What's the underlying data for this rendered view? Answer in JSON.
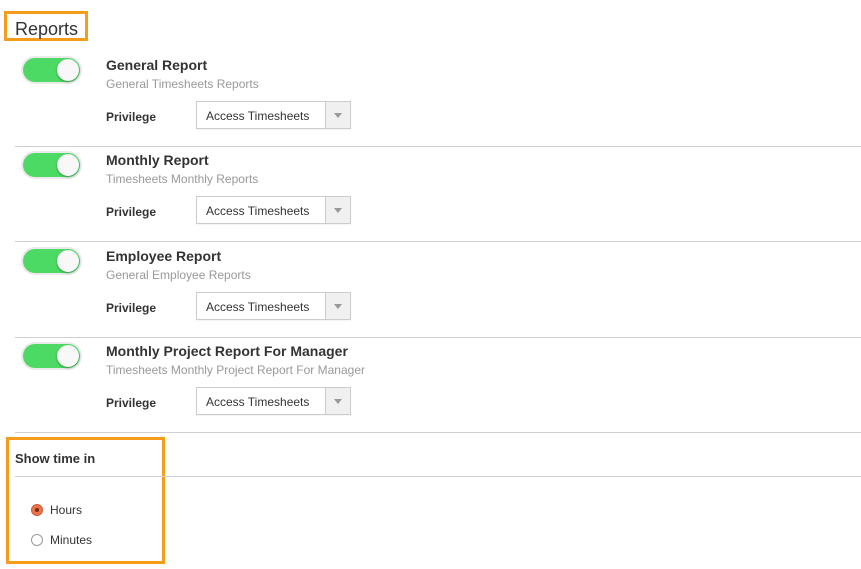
{
  "section": {
    "title": "Reports"
  },
  "reports": [
    {
      "title": "General Report",
      "subtitle": "General Timesheets Reports",
      "enabled": true,
      "privilege_label": "Privilege",
      "privilege_value": "Access Timesheets"
    },
    {
      "title": "Monthly Report",
      "subtitle": "Timesheets Monthly Reports",
      "enabled": true,
      "privilege_label": "Privilege",
      "privilege_value": "Access Timesheets"
    },
    {
      "title": "Employee Report",
      "subtitle": "General Employee Reports",
      "enabled": true,
      "privilege_label": "Privilege",
      "privilege_value": "Access Timesheets"
    },
    {
      "title": "Monthly Project Report For Manager",
      "subtitle": "Timesheets Monthly Project Report For Manager",
      "enabled": true,
      "privilege_label": "Privilege",
      "privilege_value": "Access Timesheets"
    }
  ],
  "show_time": {
    "title": "Show time in",
    "options": [
      {
        "label": "Hours",
        "checked": true
      },
      {
        "label": "Minutes",
        "checked": false
      }
    ]
  },
  "colors": {
    "toggle_on": "#4cd964",
    "highlight": "#f59c1a",
    "radio_checked": "#e9734a"
  }
}
